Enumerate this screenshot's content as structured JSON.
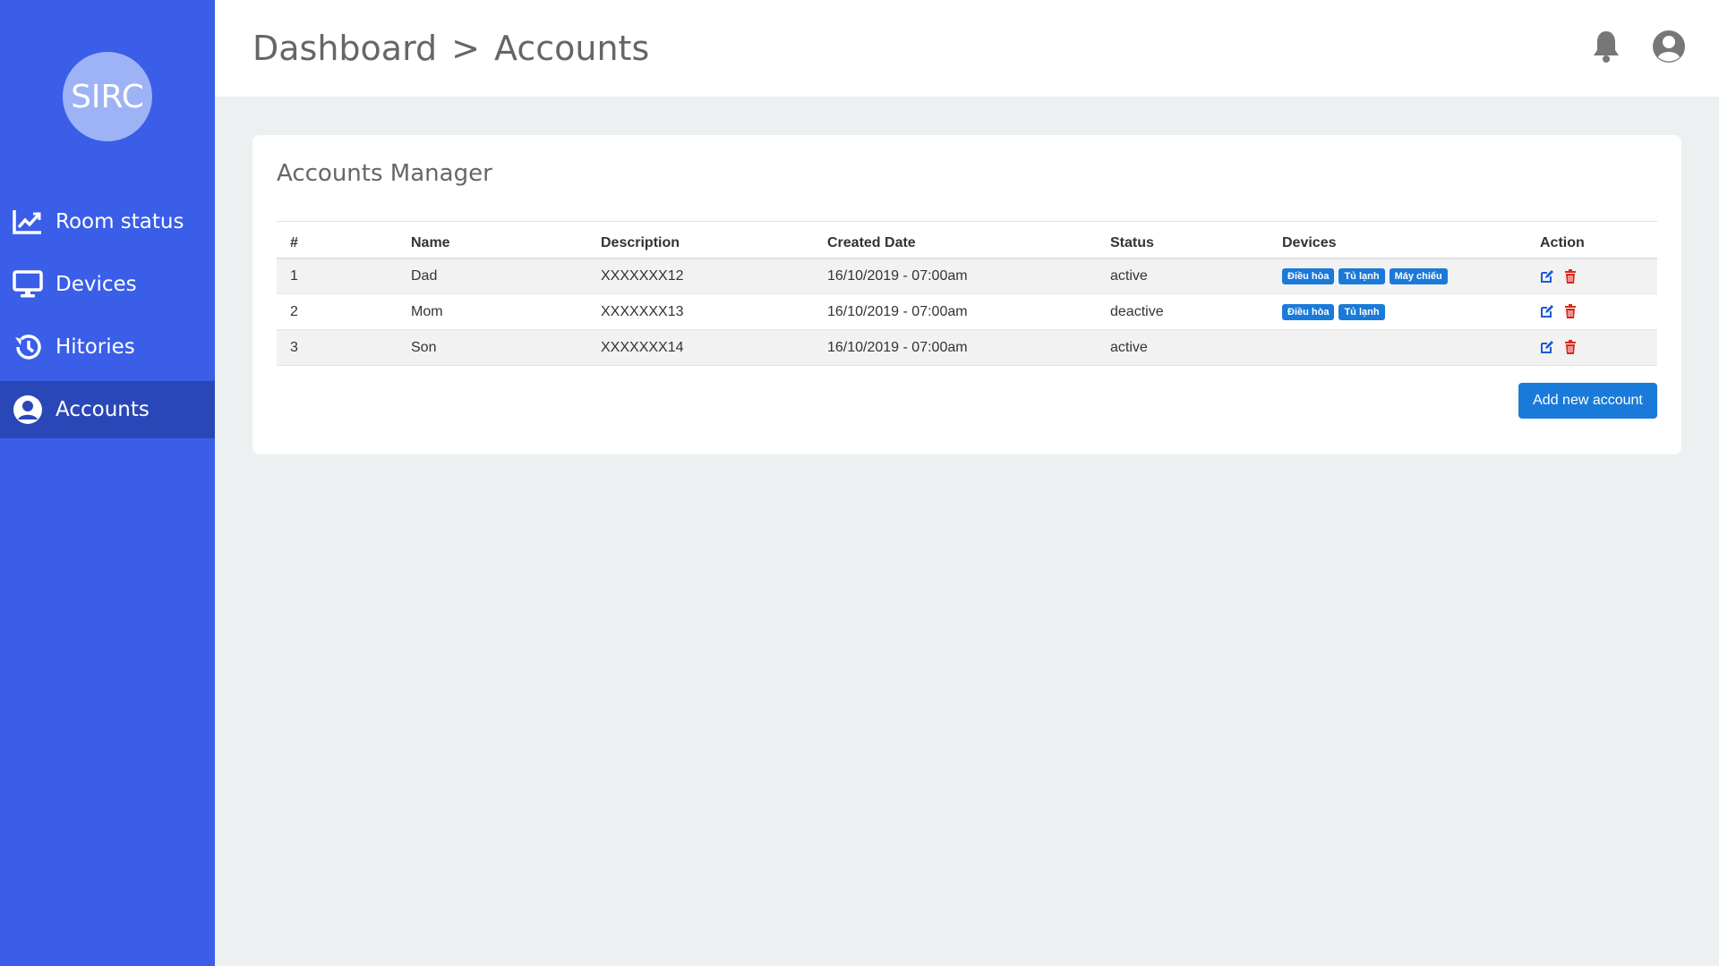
{
  "sidebar": {
    "logo_text": "SIRC",
    "items": [
      {
        "label": "Room status",
        "icon": "chart-line-icon"
      },
      {
        "label": "Devices",
        "icon": "monitor-icon"
      },
      {
        "label": "Hitories",
        "icon": "history-icon"
      },
      {
        "label": "Accounts",
        "icon": "user-circle-icon",
        "active": true
      }
    ]
  },
  "header": {
    "breadcrumb": [
      "Dashboard",
      ">",
      "Accounts"
    ],
    "icons": [
      "bell-icon",
      "user-circle-icon"
    ]
  },
  "main": {
    "title": "Accounts Manager",
    "columns": [
      "#",
      "Name",
      "Description",
      "Created Date",
      "Status",
      "Devices",
      "Action"
    ],
    "rows": [
      {
        "num": "1",
        "name": "Dad",
        "description": "XXXXXXX12",
        "created": "16/10/2019 - 07:00am",
        "status": "active",
        "devices": [
          "Điều hòa",
          "Tủ lạnh",
          "Máy chiếu"
        ]
      },
      {
        "num": "2",
        "name": "Mom",
        "description": "XXXXXXX13",
        "created": "16/10/2019 - 07:00am",
        "status": "deactive",
        "devices": [
          "Điều hòa",
          "Tủ lạnh"
        ]
      },
      {
        "num": "3",
        "name": "Son",
        "description": "XXXXXXX14",
        "created": "16/10/2019 - 07:00am",
        "status": "active",
        "devices": []
      }
    ],
    "add_button": "Add new account"
  },
  "colors": {
    "sidebar": "#3a5ee8",
    "sidebar_active": "#2a47b8",
    "primary": "#1a7ad9",
    "delete": "#d9261c"
  }
}
